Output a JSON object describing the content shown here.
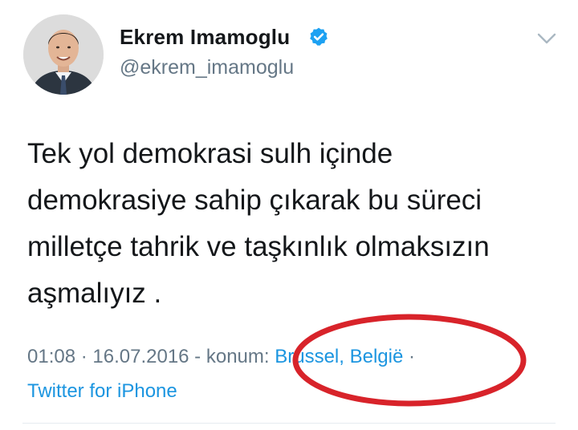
{
  "author": {
    "name": "Ekrem Imamoglu",
    "handle": "@ekrem_imamoglu",
    "verified_icon": "verified-badge-icon",
    "avatar": "profile-photo"
  },
  "menu": {
    "icon": "chevron-down-icon"
  },
  "tweet": {
    "text": "Tek yol demokrasi sulh içinde\ndemokrasiye sahip çıkarak bu süreci\nmilletçe tahrik ve taşkınlık olmaksızın\naşmalıyız ."
  },
  "meta": {
    "time": "01:08",
    "sep1": " · ",
    "date": "16.07.2016",
    "sep2": " - ",
    "location_label": "konum",
    "sep3": ": ",
    "location": "Brussel, België",
    "sep4": " ·",
    "source": "Twitter for iPhone"
  },
  "colors": {
    "link": "#1b95e0",
    "secondary": "#657786",
    "primary_text": "#14171a",
    "annotation": "#d8232a",
    "verified": "#1da1f2"
  }
}
